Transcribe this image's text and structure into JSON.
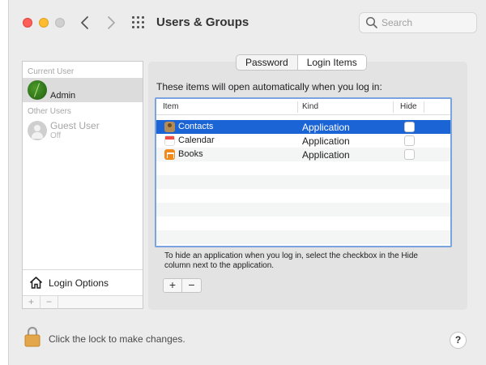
{
  "window": {
    "title": "Users & Groups",
    "search_placeholder": "Search"
  },
  "sidebar": {
    "current_user_header": "Current User",
    "current_user": {
      "name": "Admin"
    },
    "other_users_header": "Other Users",
    "other_users": [
      {
        "name": "Guest User",
        "status": "Off"
      }
    ],
    "login_options_label": "Login Options",
    "add_label": "+",
    "remove_label": "−"
  },
  "tabs": [
    {
      "label": "Password",
      "selected": false
    },
    {
      "label": "Login Items",
      "selected": true
    }
  ],
  "login_items": {
    "heading": "These items will open automatically when you log in:",
    "columns": [
      "Item",
      "Kind",
      "Hide"
    ],
    "rows": [
      {
        "item": "Contacts",
        "kind": "Application",
        "hide": false,
        "selected": true,
        "icon": "contacts-icon"
      },
      {
        "item": "Calendar",
        "kind": "Application",
        "hide": false,
        "selected": false,
        "icon": "calendar-icon"
      },
      {
        "item": "Books",
        "kind": "Application",
        "hide": false,
        "selected": false,
        "icon": "books-icon"
      }
    ],
    "help_text": "To hide an application when you log in, select the checkbox in the Hide column next to the application.",
    "add_label": "+",
    "remove_label": "−"
  },
  "footer": {
    "lock_text": "Click the lock to make changes.",
    "help_label": "?"
  },
  "colors": {
    "selection": "#1b64d6",
    "table_focus_border": "#7aa4e0",
    "traffic_red": "#fe5f57",
    "traffic_yellow": "#febc2e"
  }
}
